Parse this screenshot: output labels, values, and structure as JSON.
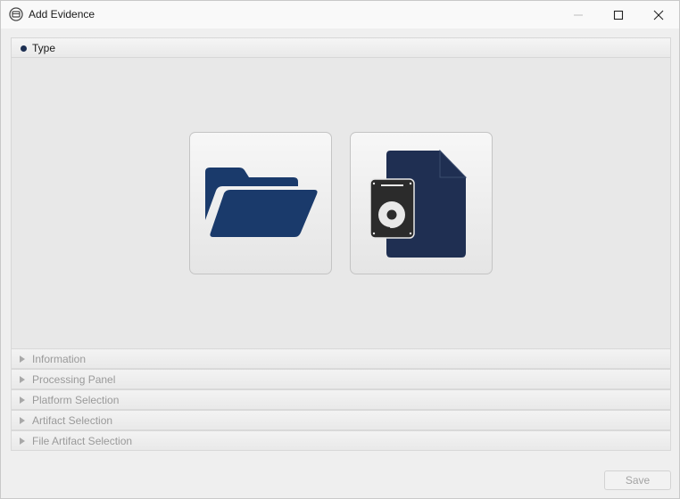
{
  "window": {
    "title": "Add Evidence",
    "controls": {
      "minimize_icon": "minimize-icon",
      "maximize_icon": "maximize-icon",
      "close_icon": "close-icon"
    }
  },
  "sections": {
    "type": {
      "label": "Type",
      "expanded": true
    },
    "collapsed": [
      {
        "label": "Information"
      },
      {
        "label": "Processing Panel"
      },
      {
        "label": "Platform Selection"
      },
      {
        "label": "Artifact Selection"
      },
      {
        "label": "File Artifact Selection"
      }
    ]
  },
  "type_options": [
    {
      "icon": "folder-open-icon"
    },
    {
      "icon": "disk-image-file-icon"
    }
  ],
  "footer": {
    "save_label": "Save"
  },
  "colors": {
    "accent": "#1a3a6b",
    "file_icon": "#1f2f52",
    "disk": "#2b2b2b",
    "disabled_text": "#9a9a9a"
  }
}
